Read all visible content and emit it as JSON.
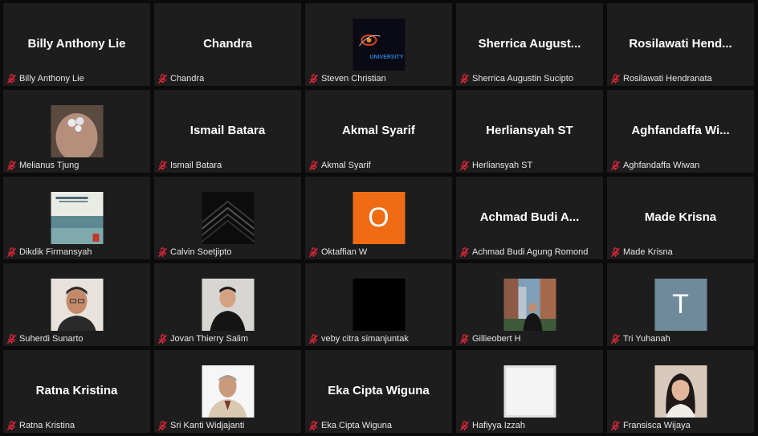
{
  "participants": [
    {
      "name": "Billy Anthony Lie",
      "tile_title": "Billy Anthony Lie",
      "display": "text"
    },
    {
      "name": "Chandra",
      "tile_title": "Chandra",
      "display": "text"
    },
    {
      "name": "Steven Christian",
      "display": "image",
      "image": "university-logo",
      "image_text": "UNIVERSITY"
    },
    {
      "name": "Sherrica Augustin Sucipto",
      "tile_title": "Sherrica August...",
      "display": "text"
    },
    {
      "name": "Rosilawati Hendranata",
      "tile_title": "Rosilawati Hend...",
      "display": "text"
    },
    {
      "name": "Melianus Tjung",
      "display": "image",
      "image": "hand-photo"
    },
    {
      "name": "Ismail Batara",
      "tile_title": "Ismail Batara",
      "display": "text"
    },
    {
      "name": "Akmal Syarif",
      "tile_title": "Akmal Syarif",
      "display": "text"
    },
    {
      "name": "Herliansyah ST",
      "tile_title": "Herliansyah ST",
      "display": "text"
    },
    {
      "name": "Aghfandaffa Wiwan",
      "tile_title": "Aghfandaffa Wi...",
      "display": "text"
    },
    {
      "name": "Dikdik Firmansyah",
      "display": "image",
      "image": "book-cover"
    },
    {
      "name": "Calvin Soetjipto",
      "display": "image",
      "image": "dark-chevrons"
    },
    {
      "name": "Oktaffian W",
      "display": "letter",
      "letter": "O",
      "color": "#ef6c15"
    },
    {
      "name": "Achmad Budi Agung Romond",
      "tile_title": "Achmad Budi A...",
      "display": "text"
    },
    {
      "name": "Made Krisna",
      "tile_title": "Made Krisna",
      "display": "text"
    },
    {
      "name": "Suherdi Sunarto",
      "display": "image",
      "image": "man-portrait"
    },
    {
      "name": "Jovan Thierry Salim",
      "display": "image",
      "image": "young-man-portrait"
    },
    {
      "name": "veby citra simanjuntak",
      "display": "image",
      "image": "black-square"
    },
    {
      "name": "Gillieobert H",
      "display": "image",
      "image": "city-photo"
    },
    {
      "name": "Tri Yuhanah",
      "display": "letter",
      "letter": "T",
      "color": "#6f8a9b"
    },
    {
      "name": "Ratna Kristina",
      "tile_title": "Ratna Kristina",
      "display": "text"
    },
    {
      "name": "Sri Kanti Widjajanti",
      "display": "image",
      "image": "older-man-portrait"
    },
    {
      "name": "Eka Cipta Wiguna",
      "tile_title": "Eka Cipta Wiguna",
      "display": "text"
    },
    {
      "name": "Hafiyya Izzah",
      "display": "image",
      "image": "white-square"
    },
    {
      "name": "Fransisca Wijaya",
      "display": "image",
      "image": "woman-portrait"
    }
  ],
  "colors": {
    "background": "#0b0b0b",
    "tile": "#1d1d1d",
    "mic_muted": "#e0263a"
  }
}
